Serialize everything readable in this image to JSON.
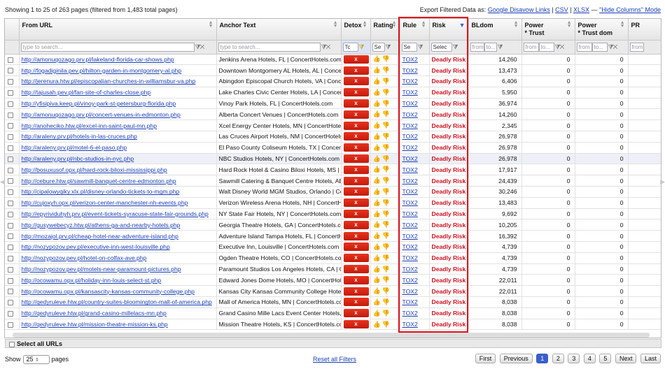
{
  "top": {
    "showing": "Showing 1 to 25 of 263 pages (filtered from 1,483 total pages)",
    "export_label": "Export Filtered Data as:",
    "export_links": [
      "Google Disavow Links",
      "CSV",
      "XLSX"
    ],
    "hide_columns": "\"Hide Columns\" Mode"
  },
  "columns": [
    "From URL",
    "Anchor Text",
    "Detox",
    "Rating",
    "Rule",
    "Risk",
    "BLdom",
    "Power\n* Trust",
    "Power\n* Trust dom",
    "PR"
  ],
  "filters": {
    "from_url_placeholder": "type to search...",
    "anchor_placeholder": "type to search...",
    "detox_value": "Tc",
    "rating_value": "Se",
    "rule_value": "Se",
    "risk_value": "Selec",
    "from": "from",
    "to": "to..."
  },
  "rows": [
    {
      "url": "http://amonuqozago.prv.pl/lakeland-florida-car-shows.php",
      "anchor": "Jenkins Arena Hotels, FL | ConcertHotels.com",
      "detox": "x",
      "rule": "TOX2",
      "risk": "Deadly Risk",
      "bldom": "14,260",
      "pt": "0",
      "ptd": "0"
    },
    {
      "url": "http://fogadiginila.pev.pl/hilton-garden-in-montgomery-al.php",
      "anchor": "Downtown Montgomery AL Hotels, AL | ConcertH",
      "detox": "x",
      "rule": "TOX2",
      "risk": "Deadly Risk",
      "bldom": "13,473",
      "pt": "0",
      "ptd": "0"
    },
    {
      "url": "http://jerenura.htw.pl/episcopalian-churches-in-williamsbur-va.php",
      "anchor": "Abingdon Episcopal Church Hotels, VA | Concert",
      "detox": "x",
      "rule": "TOX2",
      "risk": "Deadly Risk",
      "bldom": "6,406",
      "pt": "0",
      "ptd": "0"
    },
    {
      "url": "http://tajusah.pev.pl/fan-site-of-charles-close.php",
      "anchor": "Lake Charles Civic Center Hotels, LA | Concert",
      "detox": "x",
      "rule": "TOX2",
      "risk": "Deadly Risk",
      "bldom": "5,950",
      "pt": "0",
      "ptd": "0"
    },
    {
      "url": "http://yfisipiva.keep.pl/vinoy-park-st-petersburg-florida.php",
      "anchor": "Vinoy Park Hotels, FL | ConcertHotels.com",
      "detox": "x",
      "rule": "TOX2",
      "risk": "Deadly Risk",
      "bldom": "36,974",
      "pt": "0",
      "ptd": "0"
    },
    {
      "url": "http://amonuqozago.prv.pl/concert-venues-in-edmonton.php",
      "anchor": "Alberta Concert Venues | ConcertHotels.com",
      "detox": "x",
      "rule": "TOX2",
      "risk": "Deadly Risk",
      "bldom": "14,260",
      "pt": "0",
      "ptd": "0"
    },
    {
      "url": "http://anoheciko.htw.pl/excel-inn-saint-paul-mn.php",
      "anchor": "Xcel Energy Center Hotels, MN | ConcertHotels.",
      "detox": "x",
      "rule": "TOX2",
      "risk": "Deadly Risk",
      "bldom": "2,345",
      "pt": "0",
      "ptd": "0"
    },
    {
      "url": "http://araleny.prv.pl/hotels-in-las-cruces.php",
      "anchor": "Las Cruces Airport Hotels, NM | ConcertHotels.",
      "detox": "x",
      "rule": "TOX2",
      "risk": "Deadly Risk",
      "bldom": "26,978",
      "pt": "0",
      "ptd": "0"
    },
    {
      "url": "http://araleny.prv.pl/motel-6-el-paso.php",
      "anchor": "El Paso County Coliseum Hotels, TX | Concert",
      "detox": "x",
      "rule": "TOX2",
      "risk": "Deadly Risk",
      "bldom": "26,978",
      "pt": "0",
      "ptd": "0"
    },
    {
      "url": "http://araleny.prv.pl/nbc-studios-in-nyc.php",
      "anchor": "NBC Studios Hotels, NY | ConcertHotels.com",
      "detox": "x",
      "rule": "TOX2",
      "risk": "Deadly Risk",
      "bldom": "26,978",
      "pt": "0",
      "ptd": "0"
    },
    {
      "url": "http://bosuxusof.opx.pl/hard-rock-biloxi-mississippi.php",
      "anchor": "Hard Rock Hotel & Casino Biloxi Hotels, MS | C",
      "detox": "x",
      "rule": "TOX2",
      "risk": "Deadly Risk",
      "bldom": "17,917",
      "pt": "0",
      "ptd": "0"
    },
    {
      "url": "http://cebure.htw.pl/sawmill-banquet-centre-edmonton.php",
      "anchor": "Sawmill Catering & Banquet Centre Hotels, AB",
      "detox": "x",
      "rule": "TOX2",
      "risk": "Deadly Risk",
      "bldom": "24,439",
      "pt": "0",
      "ptd": "0"
    },
    {
      "url": "http://cipalowyqiky.xlx.pl/disney-orlando-tickets-to-mgm.php",
      "anchor": "Walt Disney World MGM Studios, Orlando | Con",
      "detox": "x",
      "rule": "TOX2",
      "risk": "Deadly Risk",
      "bldom": "30,246",
      "pt": "0",
      "ptd": "0"
    },
    {
      "url": "http://cujoxyh.opx.pl/verizon-center-manchester-nh-events.php",
      "anchor": "Verizon Wireless Arena Hotels, NH | ConcertHo",
      "detox": "x",
      "rule": "TOX2",
      "risk": "Deadly Risk",
      "bldom": "13,483",
      "pt": "0",
      "ptd": "0"
    },
    {
      "url": "http://epyrividuhyh.prv.pl/event-tickets-syracuse-state-fair-grounds.php",
      "anchor": "NY State Fair Hotels, NY | ConcertHotels.com",
      "detox": "x",
      "rule": "TOX2",
      "risk": "Deadly Risk",
      "bldom": "9,692",
      "pt": "0",
      "ptd": "0"
    },
    {
      "url": "http://gusywebecyz.htw.pl/athens-ga-and-nearby-hotels.php",
      "anchor": "Georgia Theatre Hotels, GA | ConcertHotels.com",
      "detox": "x",
      "rule": "TOX2",
      "risk": "Deadly Risk",
      "bldom": "10,205",
      "pt": "0",
      "ptd": "0"
    },
    {
      "url": "http://mozajol.prv.pl/cheap-hotel-near-adventure-island.php",
      "anchor": "Adventure Island Tampa Hotels, FL | ConcertHo",
      "detox": "x",
      "rule": "TOX2",
      "risk": "Deadly Risk",
      "bldom": "16,392",
      "pt": "0",
      "ptd": "0"
    },
    {
      "url": "http://nozypozov.pev.pl/executive-inn-west-louisville.php",
      "anchor": "Executive Inn, Louisville | ConcertHotels.com",
      "detox": "x",
      "rule": "TOX2",
      "risk": "Deadly Risk",
      "bldom": "4,739",
      "pt": "0",
      "ptd": "0"
    },
    {
      "url": "http://nozypozov.pev.pl/hotel-on-colfax-ave.php",
      "anchor": "Ogden Theatre Hotels, CO | ConcertHotels.com",
      "detox": "x",
      "rule": "TOX2",
      "risk": "Deadly Risk",
      "bldom": "4,739",
      "pt": "0",
      "ptd": "0"
    },
    {
      "url": "http://nozypozov.pev.pl/motels-near-paramount-pictures.php",
      "anchor": "Paramount Studios Los Angeles Hotels, CA | C",
      "detox": "x",
      "rule": "TOX2",
      "risk": "Deadly Risk",
      "bldom": "4,739",
      "pt": "0",
      "ptd": "0"
    },
    {
      "url": "http://ocowamu.opx.pl/holiday-inn-louis-select-st.php",
      "anchor": "Edward Jones Dome Hotels, MO | ConcertHotels",
      "detox": "x",
      "rule": "TOX2",
      "risk": "Deadly Risk",
      "bldom": "22,011",
      "pt": "0",
      "ptd": "0"
    },
    {
      "url": "http://ocowamu.opx.pl/kansascity-kansas-community-college.php",
      "anchor": "Kansas City Kansas Community College Hotels",
      "detox": "x",
      "rule": "TOX2",
      "risk": "Deadly Risk",
      "bldom": "22,011",
      "pt": "0",
      "ptd": "0"
    },
    {
      "url": "http://qedyruleve.htw.pl/country-suites-bloomington-mall-of-america.php",
      "anchor": "Mall of America Hotels, MN | ConcertHotels.com",
      "detox": "x",
      "rule": "TOX2",
      "risk": "Deadly Risk",
      "bldom": "8,038",
      "pt": "0",
      "ptd": "0"
    },
    {
      "url": "http://qedyruleve.htw.pl/grand-casino-millelacs-mn.php",
      "anchor": "Grand Casino Mille Lacs Event Center Hotels, I",
      "detox": "x",
      "rule": "TOX2",
      "risk": "Deadly Risk",
      "bldom": "8,038",
      "pt": "0",
      "ptd": "0"
    },
    {
      "url": "http://qedyruleve.htw.pl/mission-theatre-mission-ks.php",
      "anchor": "Mission Theatre Hotels, KS | ConcertHotels.com",
      "detox": "x",
      "rule": "TOX2",
      "risk": "Deadly Risk",
      "bldom": "8,038",
      "pt": "0",
      "ptd": "0"
    }
  ],
  "select_all": "Select all URLs",
  "bottom": {
    "show_label": "Show",
    "show_value": "25",
    "pages_label": "pages",
    "reset": "Reset all Filters",
    "first": "First",
    "previous": "Previous",
    "pages": [
      "1",
      "2",
      "3",
      "4",
      "5"
    ],
    "next": "Next",
    "last": "Last"
  }
}
